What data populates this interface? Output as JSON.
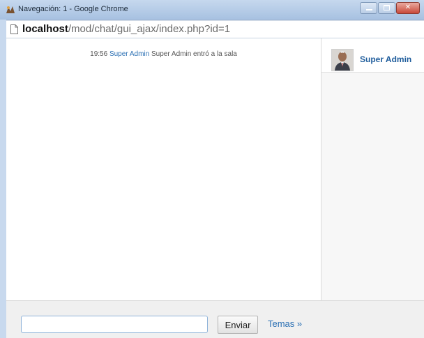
{
  "window": {
    "title": "Navegación: 1 - Google Chrome"
  },
  "address": {
    "host": "localhost",
    "path": "/mod/chat/gui_ajax/index.php?id=1"
  },
  "chat": {
    "messages": [
      {
        "time": "19:56",
        "user": "Super Admin",
        "text": "Super Admin entró a la sala"
      }
    ]
  },
  "users": [
    {
      "name": "Super Admin"
    }
  ],
  "composer": {
    "input_value": "",
    "send_label": "Enviar",
    "themes_label": "Temas »"
  },
  "colors": {
    "link": "#2a6fb3",
    "titlebar": "#b8cde8",
    "close_button": "#c9493a"
  },
  "icons": {
    "app": "chrome-icon",
    "page": "page-icon",
    "avatar": "user-avatar"
  }
}
